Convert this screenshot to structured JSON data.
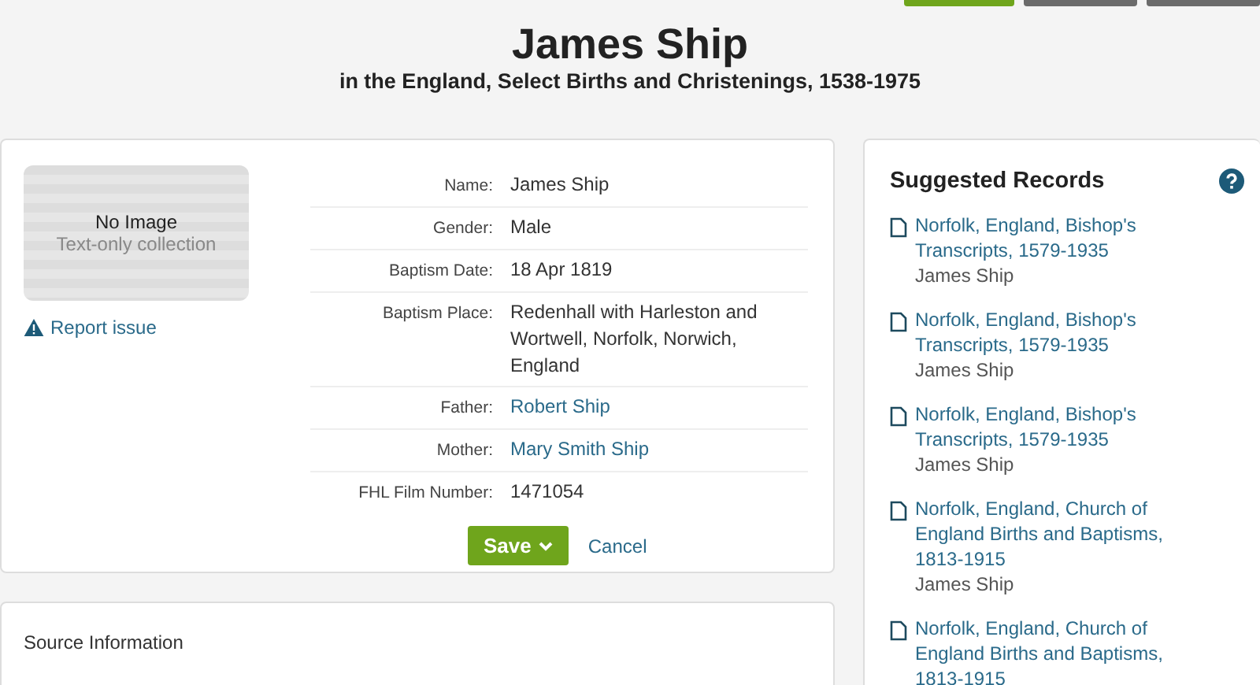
{
  "header": {
    "title": "James Ship",
    "subtitle": "in the England, Select Births and Christenings, 1538-1975"
  },
  "record": {
    "image": {
      "title": "No Image",
      "caption": "Text-only collection"
    },
    "report_link": "Report issue",
    "fields": [
      {
        "label": "Name:",
        "value": "James Ship",
        "kind": "text"
      },
      {
        "label": "Gender:",
        "value": "Male",
        "kind": "text"
      },
      {
        "label": "Baptism Date:",
        "value": "18 Apr 1819",
        "kind": "text"
      },
      {
        "label": "Baptism Place:",
        "value": "Redenhall with Harleston and Wortwell, Norfolk, Norwich, England",
        "kind": "text"
      },
      {
        "label": "Father:",
        "value": "Robert Ship",
        "kind": "link"
      },
      {
        "label": "Mother:",
        "value": "Mary Smith Ship",
        "kind": "link"
      },
      {
        "label": "FHL Film Number:",
        "value": "1471054",
        "kind": "text"
      }
    ],
    "save_button": "Save",
    "cancel_link": "Cancel"
  },
  "source": {
    "title": "Source Information"
  },
  "suggested": {
    "title": "Suggested Records",
    "items": [
      {
        "collection": "Norfolk, England, Bishop's Transcripts, 1579-1935",
        "person": "James Ship"
      },
      {
        "collection": "Norfolk, England, Bishop's Transcripts, 1579-1935",
        "person": "James Ship"
      },
      {
        "collection": "Norfolk, England, Bishop's Transcripts, 1579-1935",
        "person": "James Ship"
      },
      {
        "collection": "Norfolk, England, Church of England Births and Baptisms, 1813-1915",
        "person": "James Ship"
      },
      {
        "collection": "Norfolk, England, Church of England Births and Baptisms, 1813-1915"
      }
    ]
  }
}
